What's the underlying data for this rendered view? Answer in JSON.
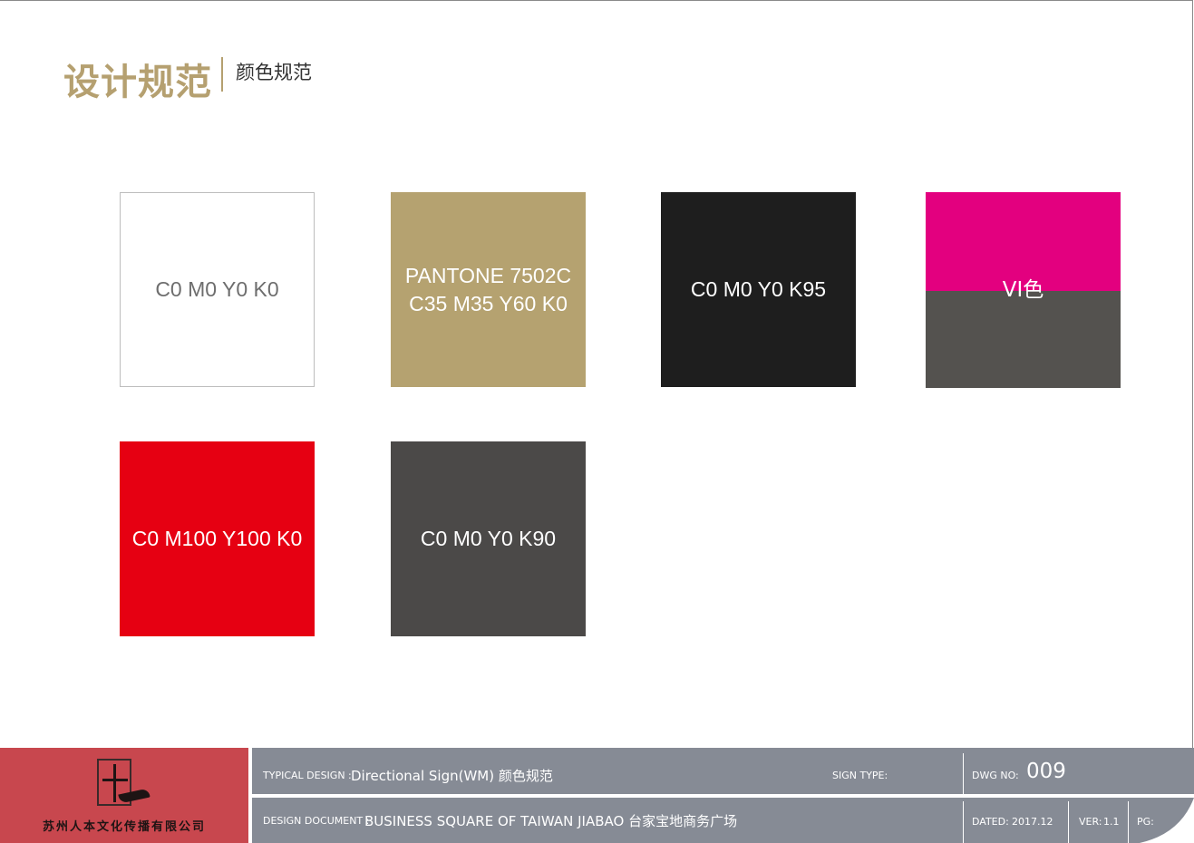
{
  "header": {
    "title": "设计规范",
    "subtitle": "颜色规范"
  },
  "swatches": [
    {
      "label_lines": [
        "C0 M0 Y0 K0"
      ],
      "color": "#ffffff"
    },
    {
      "label_lines": [
        "PANTONE 7502C",
        "C35 M35 Y60 K0"
      ],
      "color": "#b5a270"
    },
    {
      "label_lines": [
        "C0 M0 Y0 K95"
      ],
      "color": "#1e1e1e"
    },
    {
      "label_lines": [
        "VI色"
      ],
      "color_top": "#e3007f",
      "color_bottom": "#54524f"
    },
    {
      "label_lines": [
        "C0 M100 Y100 K0"
      ],
      "color": "#e60012"
    },
    {
      "label_lines": [
        "C0 M0 Y0 K90"
      ],
      "color": "#4b4948"
    }
  ],
  "footer": {
    "company": "苏州人本文化传播有限公司",
    "typical_design_label": "TYPICAL DESIGN :",
    "typical_design_value": "Directional Sign(WM)  颜色规范",
    "sign_type_label": "SIGN TYPE:",
    "dwg_no_label": "DWG NO:",
    "dwg_no_value": "009",
    "design_document_label": "DESIGN DOCUMENT :",
    "design_document_value": "BUSINESS SQUARE OF TAIWAN JIABAO 台家宝地商务广场",
    "dated_label": "DATED:",
    "dated_value": "2017.12",
    "ver_label": "VER:",
    "ver_value": "1.1",
    "pg_label": "PG:"
  },
  "colors": {
    "brand_gold": "#b5a070",
    "footer_gray": "#868b95",
    "logo_red": "#c8474e"
  }
}
